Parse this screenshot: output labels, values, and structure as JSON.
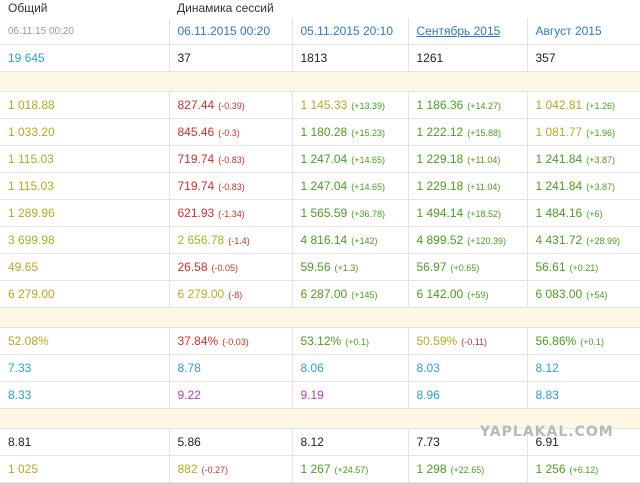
{
  "header": {
    "col_total": "Общий",
    "col_dynamics": "Динамика сессий"
  },
  "date_row": [
    "06.11.15 00:20",
    "06.11.2015 00:20",
    "05.11.2015 20:10",
    "Сентябрь 2015",
    "Август 2015"
  ],
  "colors": {
    "blue": "#2b9fd1",
    "olive": "#b3ad1f",
    "red": "#d0302c",
    "green": "#4a9e1e",
    "purple": "#b13cc9",
    "gray": "#222222",
    "sep": "#fdf8e3"
  },
  "rows": [
    {
      "type": "data",
      "cells": [
        {
          "v": "19 645",
          "c": "blue"
        },
        {
          "v": "37",
          "c": "gray"
        },
        {
          "v": "1813",
          "c": "gray"
        },
        {
          "v": "1261",
          "c": "gray"
        },
        {
          "v": "357",
          "c": "gray"
        }
      ]
    },
    {
      "type": "sep"
    },
    {
      "type": "data",
      "cells": [
        {
          "v": "1 018.88",
          "c": "olive"
        },
        {
          "v": "827.44",
          "c": "red",
          "d": "(-0.39)",
          "dc": "red"
        },
        {
          "v": "1 145.33",
          "c": "olive",
          "d": "(+13.39)",
          "dc": "green"
        },
        {
          "v": "1 186.36",
          "c": "green",
          "d": "(+14.27)",
          "dc": "green"
        },
        {
          "v": "1 042.81",
          "c": "olive",
          "d": "(+1.26)",
          "dc": "green"
        }
      ]
    },
    {
      "type": "data",
      "cells": [
        {
          "v": "1 033.20",
          "c": "olive"
        },
        {
          "v": "845.46",
          "c": "red",
          "d": "(-0.3)",
          "dc": "red"
        },
        {
          "v": "1 180.28",
          "c": "green",
          "d": "(+15.23)",
          "dc": "green"
        },
        {
          "v": "1 222.12",
          "c": "green",
          "d": "(+15.88)",
          "dc": "green"
        },
        {
          "v": "1 081.77",
          "c": "olive",
          "d": "(+1.96)",
          "dc": "green"
        }
      ]
    },
    {
      "type": "data",
      "cells": [
        {
          "v": "1 115.03",
          "c": "olive"
        },
        {
          "v": "719.74",
          "c": "red",
          "d": "(-0.83)",
          "dc": "red"
        },
        {
          "v": "1 247.04",
          "c": "green",
          "d": "(+14.65)",
          "dc": "green"
        },
        {
          "v": "1 229.18",
          "c": "green",
          "d": "(+11.04)",
          "dc": "green"
        },
        {
          "v": "1 241.84",
          "c": "green",
          "d": "(+3.87)",
          "dc": "green"
        }
      ]
    },
    {
      "type": "data",
      "cells": [
        {
          "v": "1 115.03",
          "c": "olive"
        },
        {
          "v": "719.74",
          "c": "red",
          "d": "(-0.83)",
          "dc": "red"
        },
        {
          "v": "1 247.04",
          "c": "green",
          "d": "(+14.65)",
          "dc": "green"
        },
        {
          "v": "1 229.18",
          "c": "green",
          "d": "(+11.04)",
          "dc": "green"
        },
        {
          "v": "1 241.84",
          "c": "green",
          "d": "(+3.87)",
          "dc": "green"
        }
      ]
    },
    {
      "type": "data",
      "cells": [
        {
          "v": "1 289.96",
          "c": "olive"
        },
        {
          "v": "621.93",
          "c": "red",
          "d": "(-1.34)",
          "dc": "red"
        },
        {
          "v": "1 565.59",
          "c": "green",
          "d": "(+36.78)",
          "dc": "green"
        },
        {
          "v": "1 494.14",
          "c": "green",
          "d": "(+18.52)",
          "dc": "green"
        },
        {
          "v": "1 484.16",
          "c": "green",
          "d": "(+6)",
          "dc": "green"
        }
      ]
    },
    {
      "type": "data",
      "cells": [
        {
          "v": "3 699.98",
          "c": "olive"
        },
        {
          "v": "2 656.78",
          "c": "olive",
          "d": "(-1.4)",
          "dc": "red"
        },
        {
          "v": "4 816.14",
          "c": "green",
          "d": "(+142)",
          "dc": "green"
        },
        {
          "v": "4 899.52",
          "c": "green",
          "d": "(+120.39)",
          "dc": "green"
        },
        {
          "v": "4 431.72",
          "c": "green",
          "d": "(+28.99)",
          "dc": "green"
        }
      ]
    },
    {
      "type": "data",
      "cells": [
        {
          "v": "49.65",
          "c": "olive"
        },
        {
          "v": "26.58",
          "c": "red",
          "d": "(-0.05)",
          "dc": "red"
        },
        {
          "v": "59.56",
          "c": "green",
          "d": "(+1.3)",
          "dc": "green"
        },
        {
          "v": "56.97",
          "c": "green",
          "d": "(+0.65)",
          "dc": "green"
        },
        {
          "v": "56.61",
          "c": "green",
          "d": "(+0.21)",
          "dc": "green"
        }
      ]
    },
    {
      "type": "data",
      "cells": [
        {
          "v": "6 279.00",
          "c": "olive"
        },
        {
          "v": "6 279.00",
          "c": "olive",
          "d": "(-8)",
          "dc": "red"
        },
        {
          "v": "6 287.00",
          "c": "green",
          "d": "(+145)",
          "dc": "green"
        },
        {
          "v": "6 142.00",
          "c": "green",
          "d": "(+59)",
          "dc": "green"
        },
        {
          "v": "6 083.00",
          "c": "green",
          "d": "(+54)",
          "dc": "green"
        }
      ]
    },
    {
      "type": "sep"
    },
    {
      "type": "data",
      "cells": [
        {
          "v": "52.08%",
          "c": "olive"
        },
        {
          "v": "37.84%",
          "c": "red",
          "d": "(-0.03)",
          "dc": "red"
        },
        {
          "v": "53.12%",
          "c": "green",
          "d": "(+0.1)",
          "dc": "green"
        },
        {
          "v": "50.59%",
          "c": "olive",
          "d": "(-0.11)",
          "dc": "red"
        },
        {
          "v": "56.86%",
          "c": "green",
          "d": "(+0.1)",
          "dc": "green"
        }
      ]
    },
    {
      "type": "data",
      "cells": [
        {
          "v": "7.33",
          "c": "blue"
        },
        {
          "v": "8.78",
          "c": "blue"
        },
        {
          "v": "8.06",
          "c": "blue"
        },
        {
          "v": "8.03",
          "c": "blue"
        },
        {
          "v": "8.12",
          "c": "blue"
        }
      ]
    },
    {
      "type": "data",
      "cells": [
        {
          "v": "8.33",
          "c": "blue"
        },
        {
          "v": "9.22",
          "c": "purple"
        },
        {
          "v": "9.19",
          "c": "purple"
        },
        {
          "v": "8.96",
          "c": "blue"
        },
        {
          "v": "8.83",
          "c": "blue"
        }
      ]
    },
    {
      "type": "sep"
    },
    {
      "type": "data",
      "cells": [
        {
          "v": "8.81",
          "c": "gray"
        },
        {
          "v": "5.86",
          "c": "gray"
        },
        {
          "v": "8.12",
          "c": "gray"
        },
        {
          "v": "7.73",
          "c": "gray"
        },
        {
          "v": "6.91",
          "c": "gray"
        }
      ]
    },
    {
      "type": "data",
      "cells": [
        {
          "v": "1 025",
          "c": "olive"
        },
        {
          "v": "882",
          "c": "olive",
          "d": "(-0.27)",
          "dc": "red"
        },
        {
          "v": "1 267",
          "c": "green",
          "d": "(+24.57)",
          "dc": "green"
        },
        {
          "v": "1 298",
          "c": "green",
          "d": "(+22.65)",
          "dc": "green"
        },
        {
          "v": "1 256",
          "c": "green",
          "d": "(+6.12)",
          "dc": "green"
        }
      ]
    }
  ],
  "watermark": "YAPLAKAL.COM"
}
